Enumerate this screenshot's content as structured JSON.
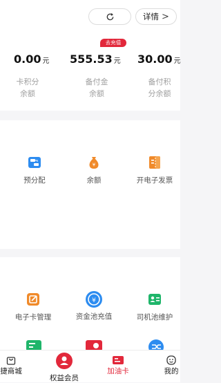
{
  "header": {
    "details_label": "详情",
    "chevron": ">",
    "refresh_icon": "refresh-icon",
    "recharge_tag": "去充值"
  },
  "balances": [
    {
      "amount": "0.00",
      "unit": "元",
      "label_line1": "卡积分",
      "label_line2": "余额"
    },
    {
      "amount": "555.53",
      "unit": "元",
      "label_line1": "备付金",
      "label_line2": "余额"
    },
    {
      "amount": "30.00",
      "unit": "元",
      "label_line1": "备付积",
      "label_line2": "分余额"
    }
  ],
  "functions_row1": [
    {
      "label": "预分配",
      "icon": "pre-allocate-icon"
    },
    {
      "label": "余额",
      "icon": "money-bag-icon"
    },
    {
      "label": "开电子发票",
      "icon": "e-invoice-icon"
    }
  ],
  "functions_row2": [
    {
      "label": "电子卡管理",
      "icon": "ecard-manage-icon"
    },
    {
      "label": "资金池充值",
      "icon": "fund-pool-icon"
    },
    {
      "label": "司机池维护",
      "icon": "driver-pool-icon"
    }
  ],
  "tabbar": {
    "mall": "捷商城",
    "rights": "权益会员",
    "fuel": "加油卡",
    "mine": "我的"
  },
  "colors": {
    "accent_red": "#e2283b",
    "blue": "#2d8cf0",
    "orange": "#f08a2a",
    "green": "#1fb56a"
  }
}
